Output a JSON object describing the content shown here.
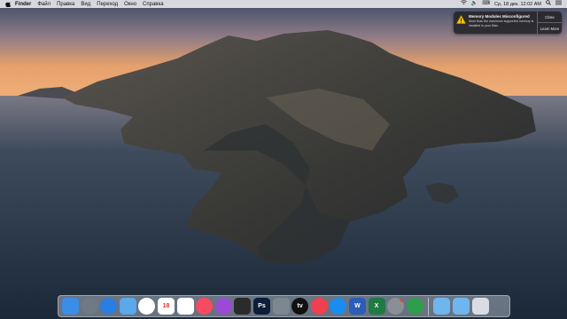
{
  "menubar": {
    "apple_icon": "apple-icon",
    "items": [
      "Finder",
      "Файл",
      "Правка",
      "Вид",
      "Переход",
      "Окно",
      "Справка"
    ],
    "status_icons": [
      "wifi-icon",
      "volume-icon",
      "input-source-icon"
    ],
    "datetime": "Ср, 18 дек. 12:02 AM",
    "search_icon": "search-icon",
    "menu_list_icon": "menu-list-icon"
  },
  "notification": {
    "icon": "warning-icon",
    "title": "Memory Modules Misconfigured",
    "text": "More than the maximum supported memory is installed in your Mac.",
    "close_label": "Close",
    "more_label": "Learn More"
  },
  "dock": {
    "apps": [
      {
        "name": "finder-icon",
        "color": "#3a8ee6"
      },
      {
        "name": "launchpad-icon",
        "color": "#6f7a86"
      },
      {
        "name": "safari-icon",
        "color": "#2a7de1"
      },
      {
        "name": "mail-icon",
        "color": "#5aa7ea"
      },
      {
        "name": "photos-icon",
        "color": "#ffffff"
      },
      {
        "name": "calendar-icon",
        "color": "#ffffff",
        "text": "18"
      },
      {
        "name": "reminders-icon",
        "color": "#ffffff"
      },
      {
        "name": "music-icon",
        "color": "#f84a61"
      },
      {
        "name": "podcasts-icon",
        "color": "#9b4ad8"
      },
      {
        "name": "final-cut-icon",
        "color": "#2b2b2b"
      },
      {
        "name": "photoshop-icon",
        "color": "#0c1e38",
        "text": "Ps"
      },
      {
        "name": "disk-utility-icon",
        "color": "#7d8790"
      },
      {
        "name": "apple-tv-icon",
        "color": "#111111",
        "text": "tv"
      },
      {
        "name": "news-icon",
        "color": "#f04050"
      },
      {
        "name": "app-store-icon",
        "color": "#1a8cf0"
      },
      {
        "name": "word-icon",
        "color": "#2b5db6",
        "text": "W"
      },
      {
        "name": "excel-icon",
        "color": "#1f7a43",
        "text": "X"
      },
      {
        "name": "system-preferences-icon",
        "color": "#8a8f96"
      },
      {
        "name": "network-utility-icon",
        "color": "#2f9e4a"
      }
    ],
    "right_items": [
      {
        "name": "applications-folder-icon",
        "color": "#6fb6ef"
      },
      {
        "name": "downloads-folder-icon",
        "color": "#6fb6ef"
      },
      {
        "name": "trash-icon",
        "color": "#d9dde3"
      }
    ],
    "badge_app": "system-preferences-icon"
  }
}
